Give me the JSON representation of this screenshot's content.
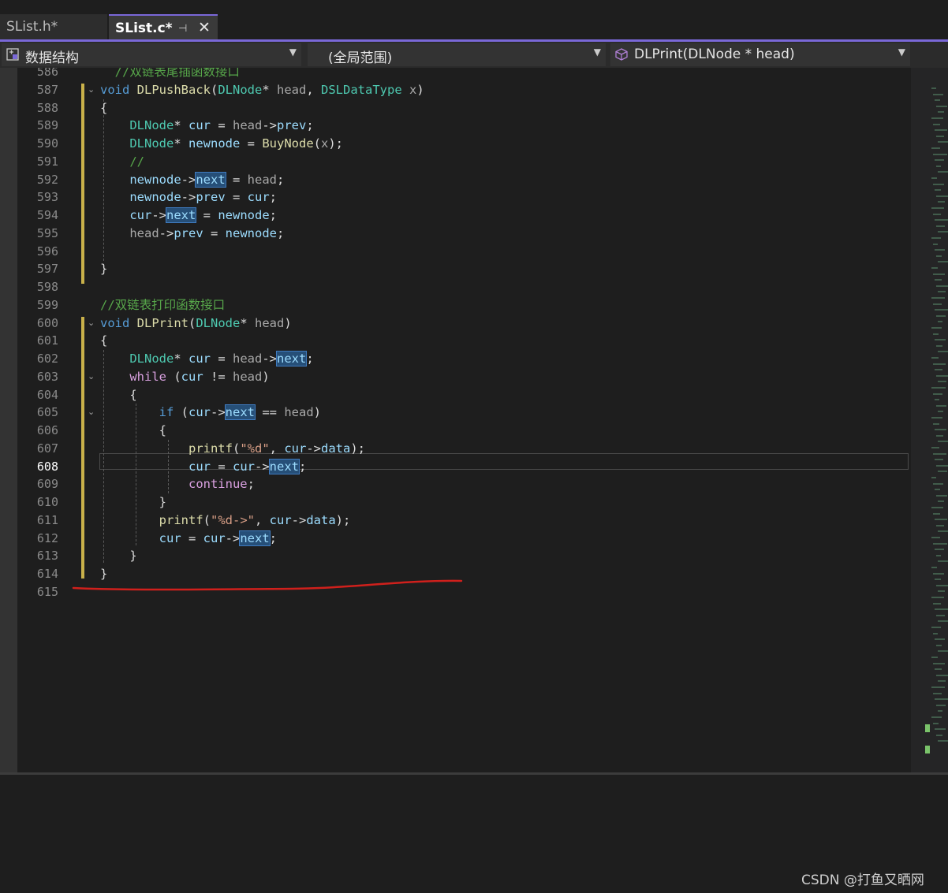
{
  "tabs": [
    {
      "label": "SList.h*",
      "active": false
    },
    {
      "label": "SList.c*",
      "active": true
    }
  ],
  "nav": {
    "project": "数据结构",
    "scope": "(全局范围)",
    "member": "DLPrint(DLNode * head)"
  },
  "code_lines": [
    {
      "n": "586",
      "text": "  //双链表尾插函数接口"
    },
    {
      "n": "587",
      "text": "void DLPushBack(DLNode* head, DSLDataType x)"
    },
    {
      "n": "588",
      "text": "{"
    },
    {
      "n": "589",
      "text": "    DLNode* cur = head->prev;"
    },
    {
      "n": "590",
      "text": "    DLNode* newnode = BuyNode(x);"
    },
    {
      "n": "591",
      "text": "    //"
    },
    {
      "n": "592",
      "text": "    newnode->next = head;"
    },
    {
      "n": "593",
      "text": "    newnode->prev = cur;"
    },
    {
      "n": "594",
      "text": "    cur->next = newnode;"
    },
    {
      "n": "595",
      "text": "    head->prev = newnode;"
    },
    {
      "n": "596",
      "text": ""
    },
    {
      "n": "597",
      "text": "}"
    },
    {
      "n": "598",
      "text": ""
    },
    {
      "n": "599",
      "text": "//双链表打印函数接口"
    },
    {
      "n": "600",
      "text": "void DLPrint(DLNode* head)"
    },
    {
      "n": "601",
      "text": "{"
    },
    {
      "n": "602",
      "text": "    DLNode* cur = head->next;"
    },
    {
      "n": "603",
      "text": "    while (cur != head)"
    },
    {
      "n": "604",
      "text": "    {"
    },
    {
      "n": "605",
      "text": "        if (cur->next == head)"
    },
    {
      "n": "606",
      "text": "        {"
    },
    {
      "n": "607",
      "text": "            printf(\"%d\", cur->data);"
    },
    {
      "n": "608",
      "text": "            cur = cur->next;"
    },
    {
      "n": "609",
      "text": "            continue;"
    },
    {
      "n": "610",
      "text": "        }"
    },
    {
      "n": "611",
      "text": "        printf(\"%d->\", cur->data);"
    },
    {
      "n": "612",
      "text": "        cur = cur->next;"
    },
    {
      "n": "613",
      "text": "    }"
    },
    {
      "n": "614",
      "text": "}"
    },
    {
      "n": "615",
      "text": ""
    }
  ],
  "active_line": "608",
  "watermark": "CSDN @打鱼又晒网",
  "colors": {
    "accent": "#7a68d8",
    "keyword": "#569cd6",
    "type": "#4ec9b0",
    "comment": "#57a64a",
    "annotation": "#d0201c"
  }
}
